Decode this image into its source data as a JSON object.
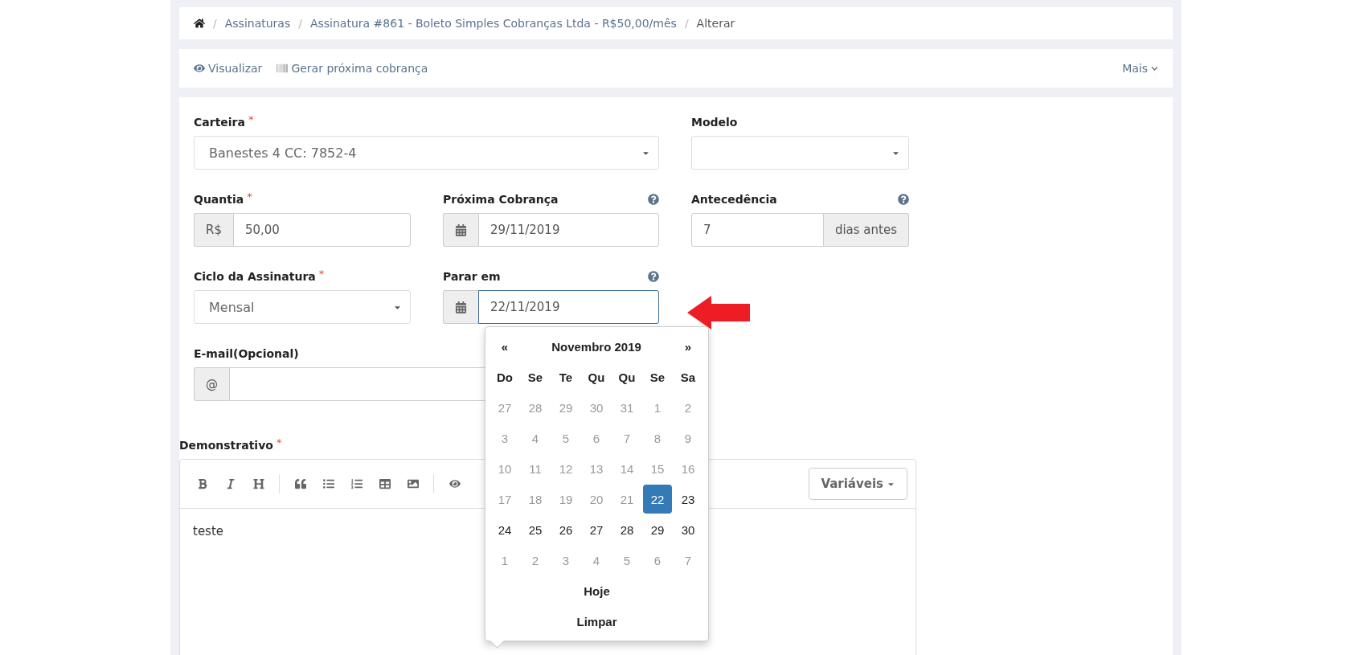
{
  "breadcrumb": {
    "separator": "/",
    "items": [
      {
        "label": "Assinaturas",
        "kind": "link"
      },
      {
        "label": "Assinatura #861 - Boleto Simples Cobranças Ltda - R$50,00/mês",
        "kind": "link"
      },
      {
        "label": "Alterar",
        "kind": "current"
      }
    ]
  },
  "actions": [
    {
      "label": "Visualizar",
      "kind": "view"
    },
    {
      "label": "Gerar próxima cobrança",
      "kind": "barcode"
    }
  ],
  "more_menu": {
    "label": "Mais"
  },
  "form": {
    "wallet": {
      "label": "Carteira",
      "required_mark": "*",
      "kind": "select",
      "value": "Banestes 4 CC: 7852-4"
    },
    "template": {
      "label": "Modelo",
      "kind": "select"
    },
    "amount": {
      "label": "Quantia",
      "required_mark": "*",
      "kind": "prefix",
      "addon": "R$",
      "value": "50,00"
    },
    "next_charge": {
      "label": "Próxima Cobrança",
      "kind": "date",
      "help": true,
      "value": "29/11/2019",
      "focused": false
    },
    "lead_time": {
      "label": "Antecedência",
      "kind": "suffix",
      "help": true,
      "addon": "dias antes",
      "value": "7"
    },
    "cycle": {
      "label": "Ciclo da Assinatura",
      "required_mark": "*",
      "kind": "select",
      "value": "Mensal"
    },
    "stop_at": {
      "label": "Parar em",
      "kind": "date",
      "help": true,
      "value": "22/11/2019",
      "focused": true,
      "calendar_open": true
    },
    "email": {
      "label": "E-mail(Opcional)",
      "kind": "prefix",
      "addon": "@"
    }
  },
  "calendar": {
    "prev": "«",
    "title": "Novembro 2019",
    "next": "»",
    "weekdays": [
      "Do",
      "Se",
      "Te",
      "Qu",
      "Qu",
      "Se",
      "Sa"
    ],
    "weeks": [
      [
        {
          "day": "27",
          "muted": true,
          "selected": false
        },
        {
          "day": "28",
          "muted": true,
          "selected": false
        },
        {
          "day": "29",
          "muted": true,
          "selected": false
        },
        {
          "day": "30",
          "muted": true,
          "selected": false
        },
        {
          "day": "31",
          "muted": true,
          "selected": false
        },
        {
          "day": "1",
          "muted": true,
          "selected": false
        },
        {
          "day": "2",
          "muted": true,
          "selected": false
        }
      ],
      [
        {
          "day": "3",
          "muted": true,
          "selected": false
        },
        {
          "day": "4",
          "muted": true,
          "selected": false
        },
        {
          "day": "5",
          "muted": true,
          "selected": false
        },
        {
          "day": "6",
          "muted": true,
          "selected": false
        },
        {
          "day": "7",
          "muted": true,
          "selected": false
        },
        {
          "day": "8",
          "muted": true,
          "selected": false
        },
        {
          "day": "9",
          "muted": true,
          "selected": false
        }
      ],
      [
        {
          "day": "10",
          "muted": true,
          "selected": false
        },
        {
          "day": "11",
          "muted": true,
          "selected": false
        },
        {
          "day": "12",
          "muted": true,
          "selected": false
        },
        {
          "day": "13",
          "muted": true,
          "selected": false
        },
        {
          "day": "14",
          "muted": true,
          "selected": false
        },
        {
          "day": "15",
          "muted": true,
          "selected": false
        },
        {
          "day": "16",
          "muted": true,
          "selected": false
        }
      ],
      [
        {
          "day": "17",
          "muted": true,
          "selected": false
        },
        {
          "day": "18",
          "muted": true,
          "selected": false
        },
        {
          "day": "19",
          "muted": true,
          "selected": false
        },
        {
          "day": "20",
          "muted": true,
          "selected": false
        },
        {
          "day": "21",
          "muted": true,
          "selected": false
        },
        {
          "day": "22",
          "muted": false,
          "selected": true
        },
        {
          "day": "23",
          "muted": false,
          "selected": false
        }
      ],
      [
        {
          "day": "24",
          "muted": false,
          "selected": false
        },
        {
          "day": "25",
          "muted": false,
          "selected": false
        },
        {
          "day": "26",
          "muted": false,
          "selected": false
        },
        {
          "day": "27",
          "muted": false,
          "selected": false
        },
        {
          "day": "28",
          "muted": false,
          "selected": false
        },
        {
          "day": "29",
          "muted": false,
          "selected": false
        },
        {
          "day": "30",
          "muted": false,
          "selected": false
        }
      ],
      [
        {
          "day": "1",
          "muted": true,
          "selected": false
        },
        {
          "day": "2",
          "muted": true,
          "selected": false
        },
        {
          "day": "3",
          "muted": true,
          "selected": false
        },
        {
          "day": "4",
          "muted": true,
          "selected": false
        },
        {
          "day": "5",
          "muted": true,
          "selected": false
        },
        {
          "day": "6",
          "muted": true,
          "selected": false
        },
        {
          "day": "7",
          "muted": true,
          "selected": false
        }
      ]
    ],
    "buttons": [
      "Hoje",
      "Limpar"
    ]
  },
  "editor": {
    "label": "Demonstrativo",
    "required_mark": "*",
    "toolbar": [
      {
        "kind": "bold"
      },
      {
        "kind": "italic"
      },
      {
        "kind": "heading"
      },
      {
        "kind": "separator"
      },
      {
        "kind": "quote"
      },
      {
        "kind": "bullet-list"
      },
      {
        "kind": "numbered-list"
      },
      {
        "kind": "table"
      },
      {
        "kind": "image"
      },
      {
        "kind": "separator"
      },
      {
        "kind": "preview"
      }
    ],
    "variables_button": "Variáveis",
    "content": "teste"
  }
}
